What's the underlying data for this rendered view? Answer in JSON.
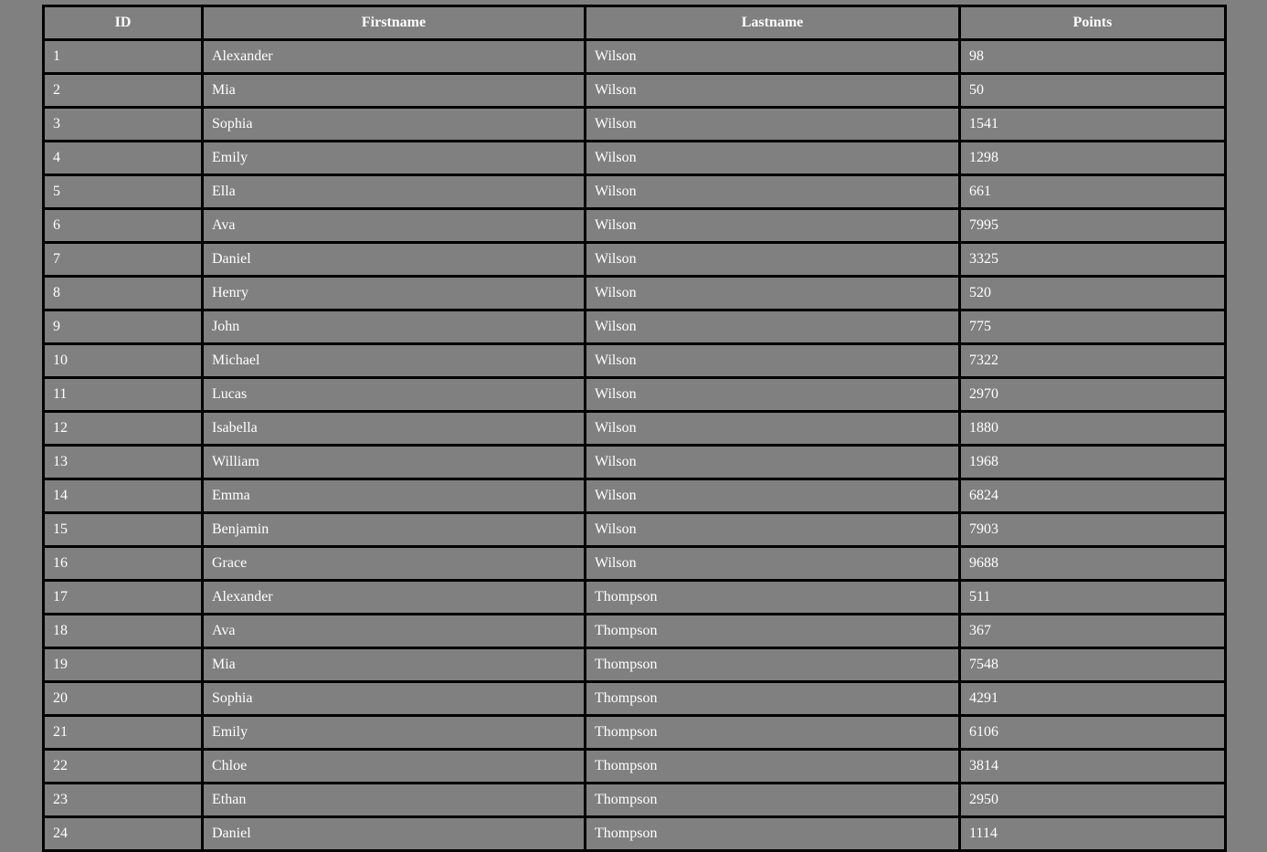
{
  "table": {
    "headers": {
      "id": "ID",
      "firstname": "Firstname",
      "lastname": "Lastname",
      "points": "Points"
    },
    "rows": [
      {
        "id": "1",
        "firstname": "Alexander",
        "lastname": "Wilson",
        "points": "98"
      },
      {
        "id": "2",
        "firstname": "Mia",
        "lastname": "Wilson",
        "points": "50"
      },
      {
        "id": "3",
        "firstname": "Sophia",
        "lastname": "Wilson",
        "points": "1541"
      },
      {
        "id": "4",
        "firstname": "Emily",
        "lastname": "Wilson",
        "points": "1298"
      },
      {
        "id": "5",
        "firstname": "Ella",
        "lastname": "Wilson",
        "points": "661"
      },
      {
        "id": "6",
        "firstname": "Ava",
        "lastname": "Wilson",
        "points": "7995"
      },
      {
        "id": "7",
        "firstname": "Daniel",
        "lastname": "Wilson",
        "points": "3325"
      },
      {
        "id": "8",
        "firstname": "Henry",
        "lastname": "Wilson",
        "points": "520"
      },
      {
        "id": "9",
        "firstname": "John",
        "lastname": "Wilson",
        "points": "775"
      },
      {
        "id": "10",
        "firstname": "Michael",
        "lastname": "Wilson",
        "points": "7322"
      },
      {
        "id": "11",
        "firstname": "Lucas",
        "lastname": "Wilson",
        "points": "2970"
      },
      {
        "id": "12",
        "firstname": "Isabella",
        "lastname": "Wilson",
        "points": "1880"
      },
      {
        "id": "13",
        "firstname": "William",
        "lastname": "Wilson",
        "points": "1968"
      },
      {
        "id": "14",
        "firstname": "Emma",
        "lastname": "Wilson",
        "points": "6824"
      },
      {
        "id": "15",
        "firstname": "Benjamin",
        "lastname": "Wilson",
        "points": "7903"
      },
      {
        "id": "16",
        "firstname": "Grace",
        "lastname": "Wilson",
        "points": "9688"
      },
      {
        "id": "17",
        "firstname": "Alexander",
        "lastname": "Thompson",
        "points": "511"
      },
      {
        "id": "18",
        "firstname": "Ava",
        "lastname": "Thompson",
        "points": "367"
      },
      {
        "id": "19",
        "firstname": "Mia",
        "lastname": "Thompson",
        "points": "7548"
      },
      {
        "id": "20",
        "firstname": "Sophia",
        "lastname": "Thompson",
        "points": "4291"
      },
      {
        "id": "21",
        "firstname": "Emily",
        "lastname": "Thompson",
        "points": "6106"
      },
      {
        "id": "22",
        "firstname": "Chloe",
        "lastname": "Thompson",
        "points": "3814"
      },
      {
        "id": "23",
        "firstname": "Ethan",
        "lastname": "Thompson",
        "points": "2950"
      },
      {
        "id": "24",
        "firstname": "Daniel",
        "lastname": "Thompson",
        "points": "1114"
      }
    ]
  },
  "colors": {
    "background": "#808080",
    "border": "#000000",
    "text": "#ffffff"
  }
}
